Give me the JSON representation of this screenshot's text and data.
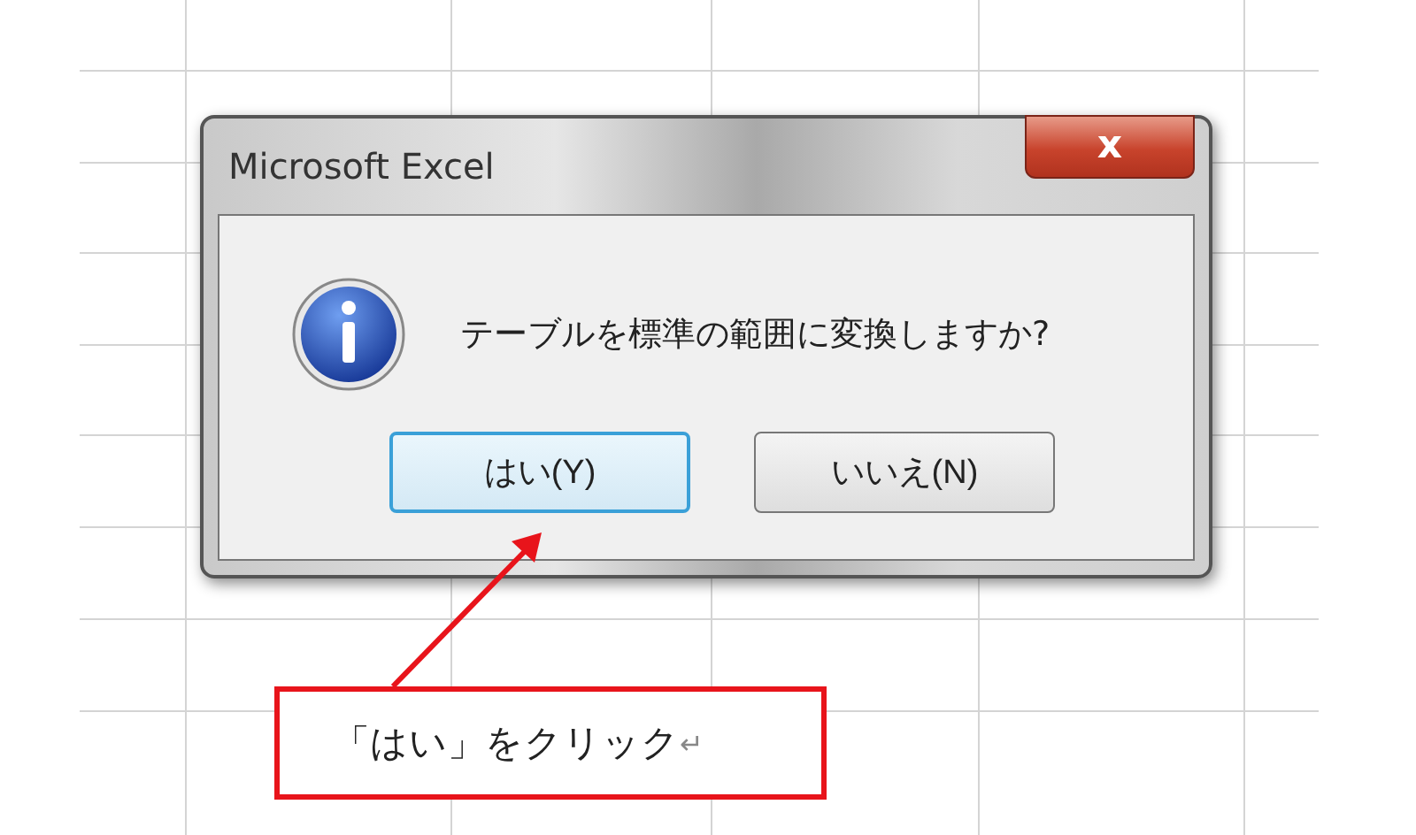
{
  "dialog": {
    "title": "Microsoft Excel",
    "close_label": "x",
    "message": "テーブルを標準の範囲に変換しますか?",
    "buttons": [
      {
        "label": "はい(Y)",
        "focused": true
      },
      {
        "label": "いいえ(N)",
        "focused": false
      }
    ]
  },
  "callout": {
    "text": "「はい」をクリック",
    "mark": "↵"
  }
}
